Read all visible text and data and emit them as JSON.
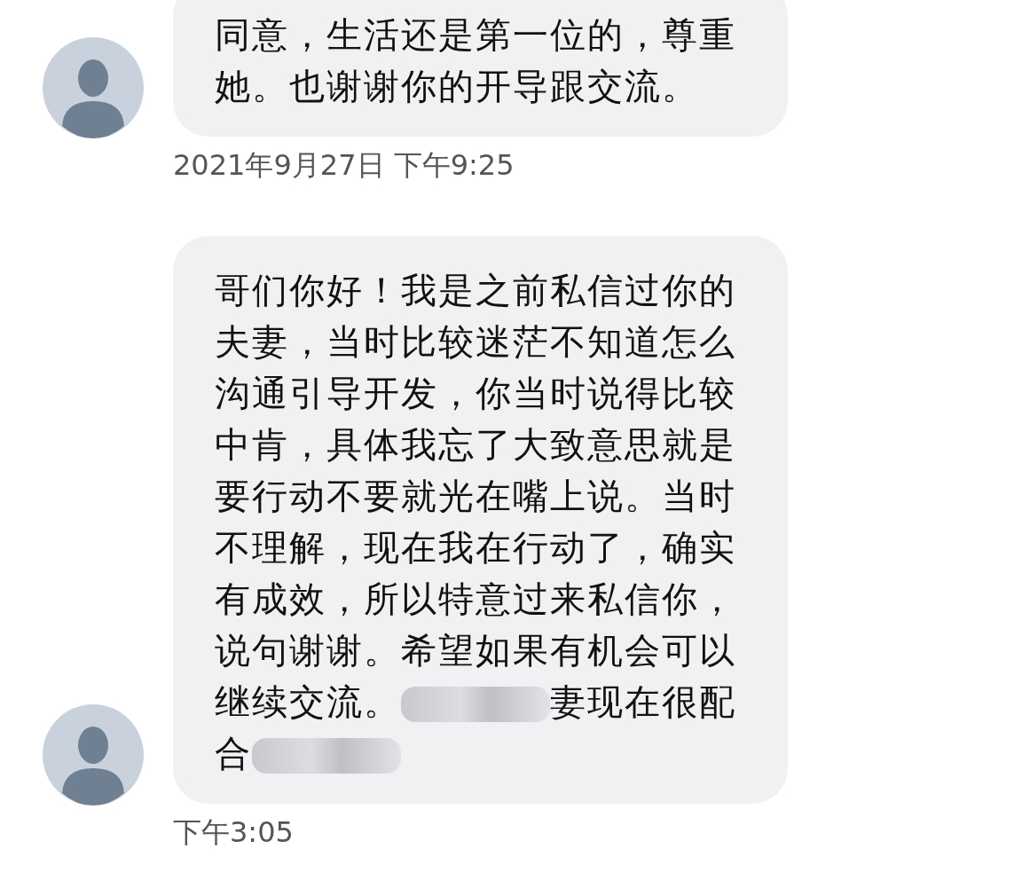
{
  "messages": [
    {
      "segments": [
        {
          "kind": "text",
          "text": "同意，生活还是第一位的，尊重她。也谢谢你的开导跟交流。"
        }
      ],
      "time": "2021年9月27日 下午9:25"
    },
    {
      "segments": [
        {
          "kind": "text",
          "text": "哥们你好！我是之前私信过你的夫妻，当时比较迷茫不知道怎么沟通引导开发，你当时说得比较中肯，具体我忘了大致意思就是要行动不要就光在嘴上说。当时不理解，现在我在行动了，确实有成效，所以特意过来私信你，说句谢谢。希望如果有机会可以"
        },
        {
          "kind": "text",
          "text": "继续交流。"
        },
        {
          "kind": "redacted"
        },
        {
          "kind": "text",
          "text": "妻现在很配"
        },
        {
          "kind": "text",
          "text": "合"
        },
        {
          "kind": "redacted"
        }
      ],
      "time": "下午3:05"
    }
  ]
}
